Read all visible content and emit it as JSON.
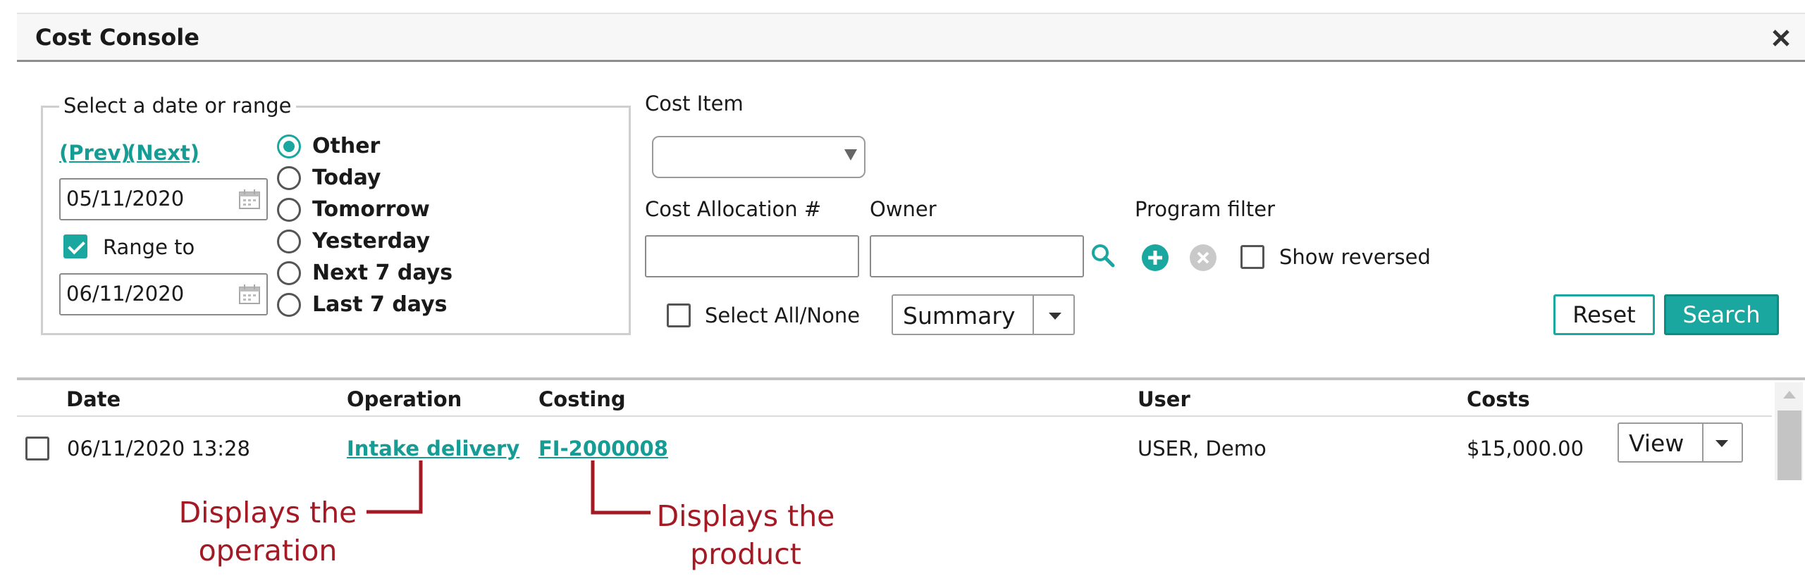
{
  "window": {
    "title": "Cost Console"
  },
  "date_panel": {
    "legend": "Select a date or range",
    "prev_link": "(Prev)",
    "next_link": "(Next)",
    "start_date": "05/11/2020",
    "range_to_label": "Range to",
    "range_to_checked": true,
    "end_date": "06/11/2020",
    "options": [
      {
        "label": "Other",
        "selected": true
      },
      {
        "label": "Today",
        "selected": false
      },
      {
        "label": "Tomorrow",
        "selected": false
      },
      {
        "label": "Yesterday",
        "selected": false
      },
      {
        "label": "Next 7 days",
        "selected": false
      },
      {
        "label": "Last 7 days",
        "selected": false
      }
    ]
  },
  "filters": {
    "cost_item_label": "Cost Item",
    "cost_item_value": "",
    "cost_allocation_label": "Cost Allocation #",
    "cost_allocation_value": "",
    "owner_label": "Owner",
    "owner_value": "",
    "program_filter_label": "Program filter",
    "show_reversed_label": "Show reversed",
    "select_all_label": "Select All/None",
    "view_mode": "Summary",
    "reset_label": "Reset",
    "search_label": "Search"
  },
  "table": {
    "columns": [
      "Date",
      "Operation",
      "Costing",
      "User",
      "Costs"
    ],
    "rows": [
      {
        "date": "06/11/2020 13:28",
        "operation": "Intake delivery",
        "costing": "FI-2000008",
        "user": "USER, Demo",
        "costs": "$15,000.00",
        "action": "View"
      }
    ]
  },
  "annotations": {
    "operation_note": [
      "Displays the",
      "operation"
    ],
    "product_note": [
      "Displays the",
      "product"
    ]
  },
  "colors": {
    "accent": "#1aa79f",
    "annotation": "#a31a25"
  }
}
